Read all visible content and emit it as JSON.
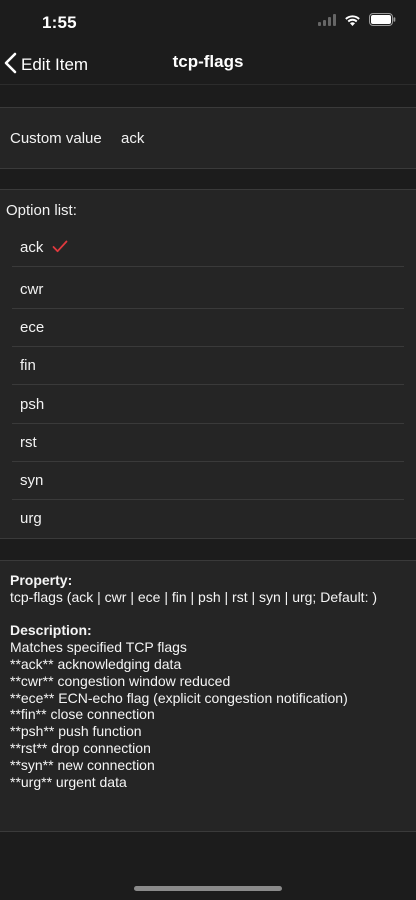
{
  "status_bar": {
    "time": "1:55",
    "icons": [
      "signal-icon",
      "wifi-icon",
      "battery-icon"
    ]
  },
  "nav": {
    "back_label": "Edit Item",
    "title": "tcp-flags"
  },
  "custom_value": {
    "label": "Custom value",
    "value": "ack"
  },
  "options": {
    "header": "Option list:",
    "items": [
      {
        "label": "ack",
        "selected": true
      },
      {
        "label": "cwr",
        "selected": false
      },
      {
        "label": "ece",
        "selected": false
      },
      {
        "label": "fin",
        "selected": false
      },
      {
        "label": "psh",
        "selected": false
      },
      {
        "label": "rst",
        "selected": false
      },
      {
        "label": "syn",
        "selected": false
      },
      {
        "label": "urg",
        "selected": false
      }
    ],
    "check_color": "#e0393e"
  },
  "description": {
    "property_heading": "Property:",
    "property_text": "tcp-flags (ack | cwr | ece | fin | psh | rst | syn | urg; Default: )",
    "description_heading": "Description:",
    "description_lines": [
      "Matches specified TCP flags",
      "**ack** acknowledging data",
      "**cwr** congestion window reduced",
      "**ece** ECN-echo flag (explicit congestion notification)",
      "**fin** close connection",
      "**psh** push function",
      "**rst** drop connection",
      "**syn** new connection",
      "**urg** urgent data"
    ]
  }
}
